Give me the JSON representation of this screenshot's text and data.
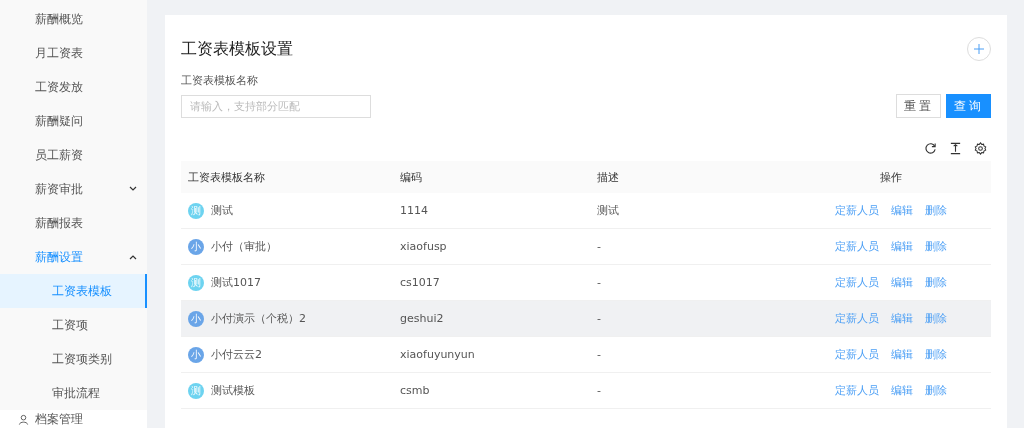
{
  "sidebar": {
    "items": [
      {
        "label": "薪酬概览",
        "selected": false
      },
      {
        "label": "月工资表",
        "selected": false
      },
      {
        "label": "工资发放",
        "selected": false
      },
      {
        "label": "薪酬疑问",
        "selected": false
      },
      {
        "label": "员工薪资",
        "selected": false
      },
      {
        "label": "薪资审批",
        "selected": false,
        "expanded": false
      },
      {
        "label": "薪酬报表",
        "selected": false
      },
      {
        "label": "薪酬设置",
        "selected": false,
        "expanded": true,
        "children": [
          {
            "label": "工资表模板",
            "selected": true
          },
          {
            "label": "工资项",
            "selected": false
          },
          {
            "label": "工资项类别",
            "selected": false
          },
          {
            "label": "审批流程",
            "selected": false
          }
        ]
      }
    ],
    "footer_item": {
      "label": "档案管理"
    }
  },
  "page": {
    "title": "工资表模板设置",
    "filter": {
      "label": "工资表模板名称",
      "placeholder": "请输入，支持部分匹配"
    },
    "buttons": [
      {
        "label": "重置",
        "kind": "default"
      },
      {
        "label": "查询",
        "kind": "primary"
      }
    ]
  },
  "table": {
    "columns": [
      "工资表模板名称",
      "编码",
      "描述",
      "操作"
    ],
    "rows": [
      {
        "avatar": "测",
        "color": "#6dd3f0",
        "name": "测试",
        "code": "1114",
        "description": "测试",
        "actions": [
          "定薪人员",
          "编辑",
          "删除"
        ],
        "highlighted": false
      },
      {
        "avatar": "小",
        "color": "#6aa5e8",
        "name": "小付（审批）",
        "code": "xiaofusp",
        "description": "-",
        "actions": [
          "定薪人员",
          "编辑",
          "删除"
        ],
        "highlighted": false
      },
      {
        "avatar": "测",
        "color": "#6dd3f0",
        "name": "测试1017",
        "code": "cs1017",
        "description": "-",
        "actions": [
          "定薪人员",
          "编辑",
          "删除"
        ],
        "highlighted": false
      },
      {
        "avatar": "小",
        "color": "#6aa5e8",
        "name": "小付演示（个税）2",
        "code": "geshui2",
        "description": "-",
        "actions": [
          "定薪人员",
          "编辑",
          "删除"
        ],
        "highlighted": true
      },
      {
        "avatar": "小",
        "color": "#6aa5e8",
        "name": "小付云云2",
        "code": "xiaofuyunyun",
        "description": "-",
        "actions": [
          "定薪人员",
          "编辑",
          "删除"
        ],
        "highlighted": false
      },
      {
        "avatar": "测",
        "color": "#6dd3f0",
        "name": "测试模板",
        "code": "csmb",
        "description": "-",
        "actions": [
          "定薪人员",
          "编辑",
          "删除"
        ],
        "highlighted": false
      }
    ]
  }
}
